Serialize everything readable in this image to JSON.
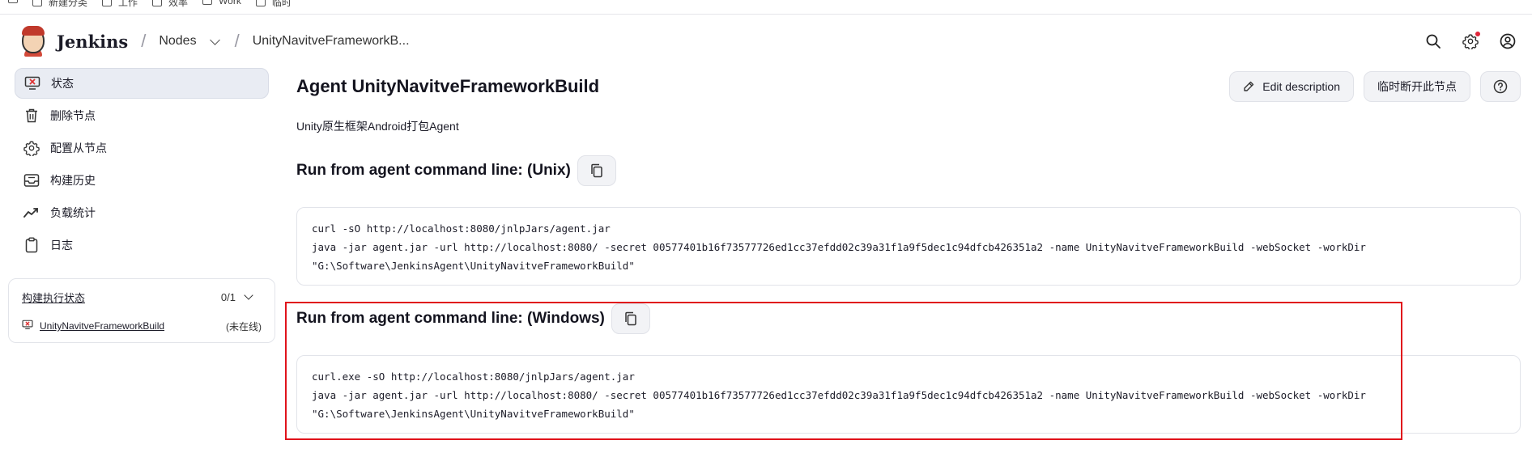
{
  "bookmarks": [
    "新建分类",
    "工作",
    "效率",
    "Work",
    "临时"
  ],
  "header": {
    "brand": "Jenkins",
    "crumb_nodes": "Nodes",
    "crumb_agent": "UnityNavitveFrameworkB..."
  },
  "sidebar": {
    "items": [
      {
        "label": "状态",
        "icon": "monitor-x-icon",
        "active": true
      },
      {
        "label": "删除节点",
        "icon": "trash-icon",
        "active": false
      },
      {
        "label": "配置从节点",
        "icon": "gear-icon",
        "active": false
      },
      {
        "label": "构建历史",
        "icon": "inbox-icon",
        "active": false
      },
      {
        "label": "负载统计",
        "icon": "trend-icon",
        "active": false
      },
      {
        "label": "日志",
        "icon": "clipboard-icon",
        "active": false
      }
    ],
    "executor": {
      "title": "构建执行状态",
      "count": "0/1",
      "agent_name": "UnityNavitveFrameworkBuild",
      "agent_state": "(未在线)"
    }
  },
  "main": {
    "title": "Agent UnityNavitveFrameworkBuild",
    "edit_description": "Edit description",
    "disconnect": "临时断开此节点",
    "description": "Unity原生框架Android打包Agent",
    "unix": {
      "heading": "Run from agent command line: (Unix)",
      "lines": [
        "curl -sO http://localhost:8080/jnlpJars/agent.jar",
        "java -jar agent.jar -url http://localhost:8080/ -secret 00577401b16f73577726ed1cc37efdd02c39a31f1a9f5dec1c94dfcb426351a2 -name UnityNavitveFrameworkBuild -webSocket -workDir",
        "\"G:\\Software\\JenkinsAgent\\UnityNavitveFrameworkBuild\""
      ]
    },
    "windows": {
      "heading": "Run from agent command line: (Windows)",
      "lines": [
        "curl.exe -sO http://localhost:8080/jnlpJars/agent.jar",
        "java -jar agent.jar -url http://localhost:8080/ -secret 00577401b16f73577726ed1cc37efdd02c39a31f1a9f5dec1c94dfcb426351a2 -name UnityNavitveFrameworkBuild -webSocket -workDir",
        "\"G:\\Software\\JenkinsAgent\\UnityNavitveFrameworkBuild\""
      ]
    }
  },
  "colors": {
    "highlight": "#e0131b",
    "notification": "#e0263a",
    "accent_error": "#d33"
  }
}
